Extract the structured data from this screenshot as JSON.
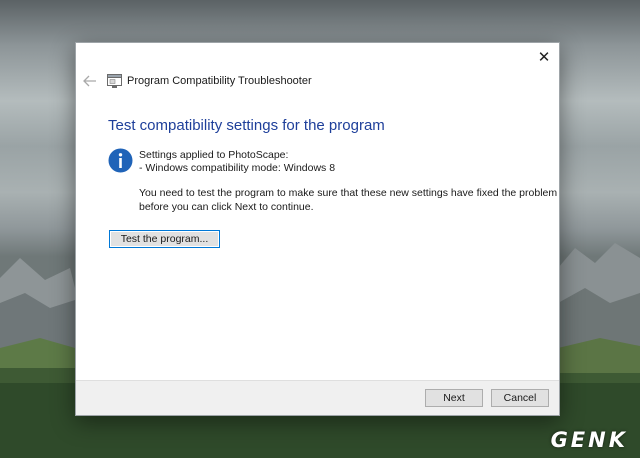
{
  "window": {
    "title": "Program Compatibility Troubleshooter",
    "close_glyph": "✕",
    "icons": [
      "back-arrow-icon",
      "troubleshooter-icon",
      "close-icon"
    ]
  },
  "content": {
    "heading": "Test compatibility settings for the program",
    "info_icon": "info-icon",
    "settings_line1": "Settings applied to PhotoScape:",
    "settings_line2": "- Windows compatibility mode: Windows 8",
    "message_line1": "You need to test the program to make sure that these new settings have fixed the problem",
    "message_line2": "before you can click Next to continue.",
    "test_button_label": "Test the program..."
  },
  "footer": {
    "next_label": "Next",
    "cancel_label": "Cancel"
  },
  "watermark": "GENK",
  "colors": {
    "heading": "#1e3f9a",
    "info_icon": "#1f63b8",
    "focus_border": "#0078d7",
    "footer_bg": "#f0f0f0"
  }
}
